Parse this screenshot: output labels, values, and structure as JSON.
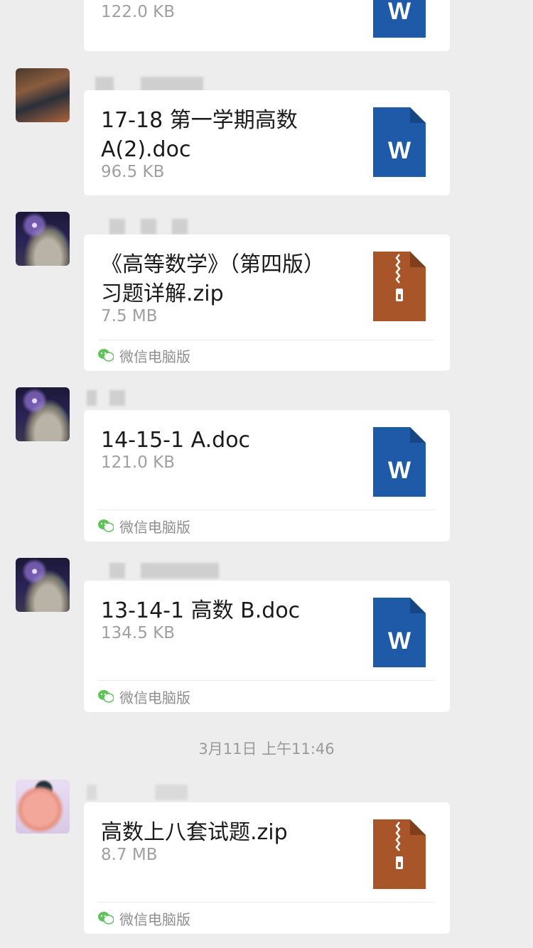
{
  "messages": [
    {
      "file_name": "",
      "file_size": "122.0 KB",
      "file_type": "word-doc-icon",
      "source": ""
    },
    {
      "file_name": "17-18 第一学期高数 A(2).doc",
      "file_size": "96.5 KB",
      "file_type": "word-doc-icon",
      "source": ""
    },
    {
      "file_name": "《高等数学》（第四版）习题详解.zip",
      "file_size": "7.5 MB",
      "file_type": "zip-archive-icon",
      "source": "微信电脑版"
    },
    {
      "file_name": "14-15-1 A.doc",
      "file_size": "121.0 KB",
      "file_type": "word-doc-icon",
      "source": "微信电脑版"
    },
    {
      "file_name": "13-14-1 高数 B.doc",
      "file_size": "134.5 KB",
      "file_type": "word-doc-icon",
      "source": "微信电脑版"
    },
    {
      "file_name": "高数上八套试题.zip",
      "file_size": "8.7 MB",
      "file_type": "zip-archive-icon",
      "source": "微信电脑版"
    }
  ],
  "timestamp": "3月11日 上午11:46",
  "icon_glyphs": {
    "word": "W"
  },
  "colors": {
    "background": "#ededed",
    "bubble": "#ffffff",
    "word_icon": "#1f5aa8",
    "zip_icon": "#a8552a",
    "wechat_green": "#5fc35a"
  }
}
